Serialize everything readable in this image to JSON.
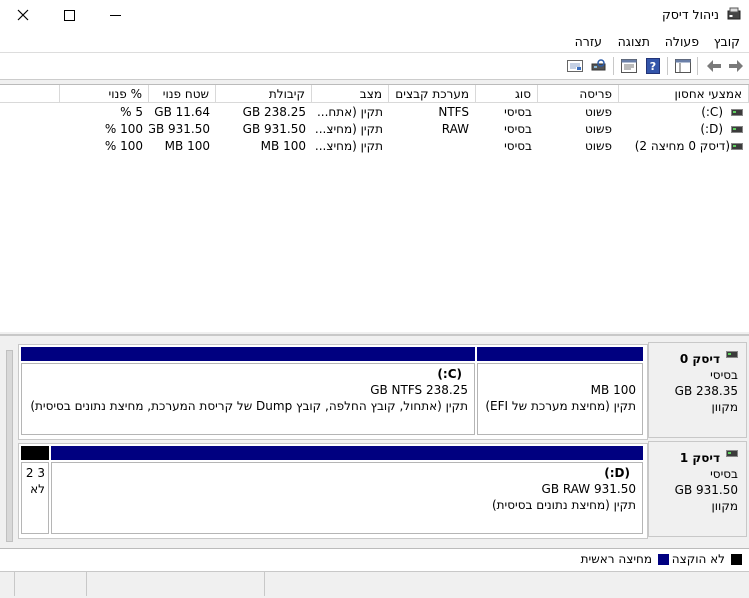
{
  "window": {
    "title": "ניהול דיסק"
  },
  "menu": [
    "קובץ",
    "פעולה",
    "תצוגה",
    "עזרה"
  ],
  "list": {
    "columns": [
      "אמצעי אחסון",
      "פריסה",
      "סוג",
      "מערכת קבצים",
      "מצב",
      "קיבולת",
      "שטח פנוי",
      "% פנוי"
    ],
    "rows": [
      {
        "volume": "(C:)",
        "layout": "פשוט",
        "type": "בסיסי",
        "fs": "NTFS",
        "status": "תקין (אתח...",
        "capacity": "238.25 GB",
        "free": "11.64 GB",
        "pct": "5 %"
      },
      {
        "volume": "(D:)",
        "layout": "פשוט",
        "type": "בסיסי",
        "fs": "RAW",
        "status": "תקין (מחיצ...",
        "capacity": "931.50 GB",
        "free": "931.50 GB",
        "pct": "100 %"
      },
      {
        "volume": "(דיסק 0 מחיצה 2)",
        "layout": "פשוט",
        "type": "בסיסי",
        "fs": "",
        "status": "תקין (מחיצ...",
        "capacity": "100 MB",
        "free": "100 MB",
        "pct": "100 %"
      }
    ]
  },
  "disks": [
    {
      "name": "דיסק 0",
      "kind": "בסיסי",
      "size": "238.35 GB",
      "state": "מקוון",
      "partitions": [
        {
          "size": "100 MB",
          "status": "תקין (מחיצת מערכת של EFI)"
        },
        {
          "title": "(C:)",
          "size": "238.25 GB NTFS",
          "status": "תקין (אתחול, קובץ החלפה, קובץ Dump של קריסת המערכת, מחיצת נתונים בסיסית)"
        }
      ]
    },
    {
      "name": "דיסק 1",
      "kind": "בסיסי",
      "size": "931.50 GB",
      "state": "מקוון",
      "partitions": [
        {
          "title": "(D:)",
          "size": "931.50 GB RAW",
          "status": "תקין (מחיצת נתונים בסיסית)"
        }
      ],
      "unallocated": {
        "line1": "3 2",
        "line2": "לא"
      }
    }
  ],
  "legend": [
    {
      "label": "לא הוקצה",
      "color": "#000000"
    },
    {
      "label": "מחיצה ראשית",
      "color": "#000080"
    }
  ],
  "colors": {
    "accent": "#000080",
    "volume_icon_led": "#5fd15f"
  }
}
